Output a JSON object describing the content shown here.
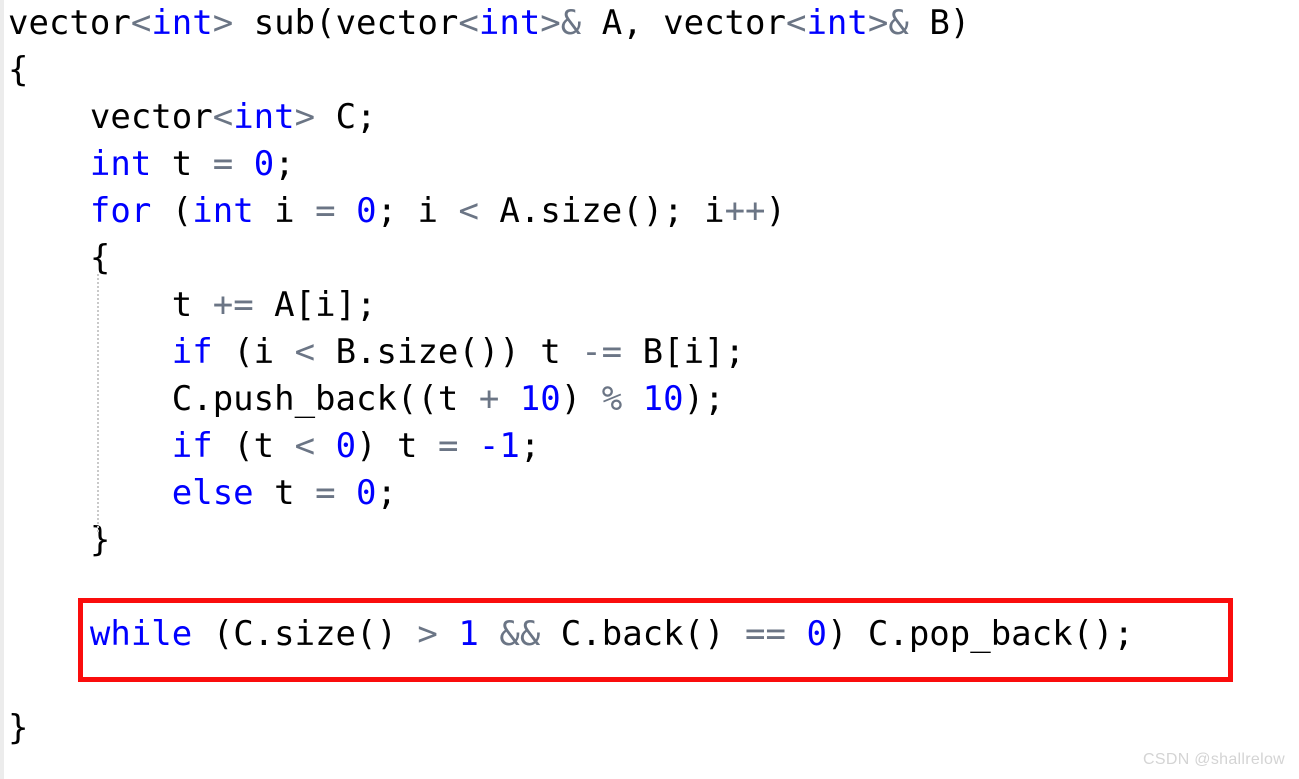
{
  "editor": {
    "language": "cpp",
    "background_color": "#ffffff",
    "default_text_color": "#000000",
    "keyword_color": "#0000ff",
    "number_color": "#0000ff",
    "operator_color": "#6b7585",
    "highlight_border_color": "#fa0d0d",
    "gutter_color": "#ececec",
    "indent_guide_color": "#c9c9c9",
    "lines": [
      {
        "indent": "",
        "tokens": [
          {
            "t": "vector",
            "c": "plain"
          },
          {
            "t": "<",
            "c": "op"
          },
          {
            "t": "int",
            "c": "kw"
          },
          {
            "t": ">",
            "c": "op"
          },
          {
            "t": " sub(vector",
            "c": "plain"
          },
          {
            "t": "<",
            "c": "op"
          },
          {
            "t": "int",
            "c": "kw"
          },
          {
            "t": ">",
            "c": "op"
          },
          {
            "t": "&",
            "c": "op"
          },
          {
            "t": " A, vector",
            "c": "plain"
          },
          {
            "t": "<",
            "c": "op"
          },
          {
            "t": "int",
            "c": "kw"
          },
          {
            "t": ">",
            "c": "op"
          },
          {
            "t": "&",
            "c": "op"
          },
          {
            "t": " B)",
            "c": "plain"
          }
        ]
      },
      {
        "indent": "",
        "tokens": [
          {
            "t": "{",
            "c": "plain"
          }
        ]
      },
      {
        "indent": "    ",
        "tokens": [
          {
            "t": "vector",
            "c": "plain"
          },
          {
            "t": "<",
            "c": "op"
          },
          {
            "t": "int",
            "c": "kw"
          },
          {
            "t": ">",
            "c": "op"
          },
          {
            "t": " C;",
            "c": "plain"
          }
        ]
      },
      {
        "indent": "    ",
        "tokens": [
          {
            "t": "int",
            "c": "kw"
          },
          {
            "t": " t ",
            "c": "plain"
          },
          {
            "t": "=",
            "c": "op"
          },
          {
            "t": " ",
            "c": "plain"
          },
          {
            "t": "0",
            "c": "num"
          },
          {
            "t": ";",
            "c": "plain"
          }
        ]
      },
      {
        "indent": "    ",
        "tokens": [
          {
            "t": "for",
            "c": "kw"
          },
          {
            "t": " (",
            "c": "plain"
          },
          {
            "t": "int",
            "c": "kw"
          },
          {
            "t": " i ",
            "c": "plain"
          },
          {
            "t": "=",
            "c": "op"
          },
          {
            "t": " ",
            "c": "plain"
          },
          {
            "t": "0",
            "c": "num"
          },
          {
            "t": "; i ",
            "c": "plain"
          },
          {
            "t": "<",
            "c": "op"
          },
          {
            "t": " A.size(); i",
            "c": "plain"
          },
          {
            "t": "++",
            "c": "op"
          },
          {
            "t": ")",
            "c": "plain"
          }
        ]
      },
      {
        "indent": "    ",
        "tokens": [
          {
            "t": "{",
            "c": "plain"
          }
        ]
      },
      {
        "indent": "        ",
        "tokens": [
          {
            "t": "t ",
            "c": "plain"
          },
          {
            "t": "+=",
            "c": "op"
          },
          {
            "t": " A[i];",
            "c": "plain"
          }
        ]
      },
      {
        "indent": "        ",
        "tokens": [
          {
            "t": "if",
            "c": "kw"
          },
          {
            "t": " (i ",
            "c": "plain"
          },
          {
            "t": "<",
            "c": "op"
          },
          {
            "t": " B.size()) t ",
            "c": "plain"
          },
          {
            "t": "-=",
            "c": "op"
          },
          {
            "t": " B[i];",
            "c": "plain"
          }
        ]
      },
      {
        "indent": "        ",
        "tokens": [
          {
            "t": "C.push_back((t ",
            "c": "plain"
          },
          {
            "t": "+",
            "c": "op"
          },
          {
            "t": " ",
            "c": "plain"
          },
          {
            "t": "10",
            "c": "num"
          },
          {
            "t": ") ",
            "c": "plain"
          },
          {
            "t": "%",
            "c": "op"
          },
          {
            "t": " ",
            "c": "plain"
          },
          {
            "t": "10",
            "c": "num"
          },
          {
            "t": ");",
            "c": "plain"
          }
        ]
      },
      {
        "indent": "        ",
        "tokens": [
          {
            "t": "if",
            "c": "kw"
          },
          {
            "t": " (t ",
            "c": "plain"
          },
          {
            "t": "<",
            "c": "op"
          },
          {
            "t": " ",
            "c": "plain"
          },
          {
            "t": "0",
            "c": "num"
          },
          {
            "t": ") t ",
            "c": "plain"
          },
          {
            "t": "=",
            "c": "op"
          },
          {
            "t": " ",
            "c": "plain"
          },
          {
            "t": "-1",
            "c": "num"
          },
          {
            "t": ";",
            "c": "plain"
          }
        ]
      },
      {
        "indent": "        ",
        "tokens": [
          {
            "t": "else",
            "c": "kw"
          },
          {
            "t": " t ",
            "c": "plain"
          },
          {
            "t": "=",
            "c": "op"
          },
          {
            "t": " ",
            "c": "plain"
          },
          {
            "t": "0",
            "c": "num"
          },
          {
            "t": ";",
            "c": "plain"
          }
        ]
      },
      {
        "indent": "    ",
        "tokens": [
          {
            "t": "}",
            "c": "plain"
          }
        ]
      },
      {
        "indent": "",
        "tokens": []
      },
      {
        "indent": "    ",
        "highlighted": true,
        "tokens": [
          {
            "t": "while",
            "c": "kw"
          },
          {
            "t": " (C.size() ",
            "c": "plain"
          },
          {
            "t": ">",
            "c": "op"
          },
          {
            "t": " ",
            "c": "plain"
          },
          {
            "t": "1",
            "c": "num"
          },
          {
            "t": " ",
            "c": "plain"
          },
          {
            "t": "&&",
            "c": "op"
          },
          {
            "t": " C.back() ",
            "c": "plain"
          },
          {
            "t": "==",
            "c": "op"
          },
          {
            "t": " ",
            "c": "plain"
          },
          {
            "t": "0",
            "c": "num"
          },
          {
            "t": ") C.pop_back();",
            "c": "plain"
          }
        ]
      },
      {
        "indent": "",
        "tokens": []
      },
      {
        "indent": "",
        "tokens": [
          {
            "t": "}",
            "c": "plain"
          }
        ]
      }
    ]
  },
  "watermark": {
    "text": "CSDN @shallrelow"
  }
}
